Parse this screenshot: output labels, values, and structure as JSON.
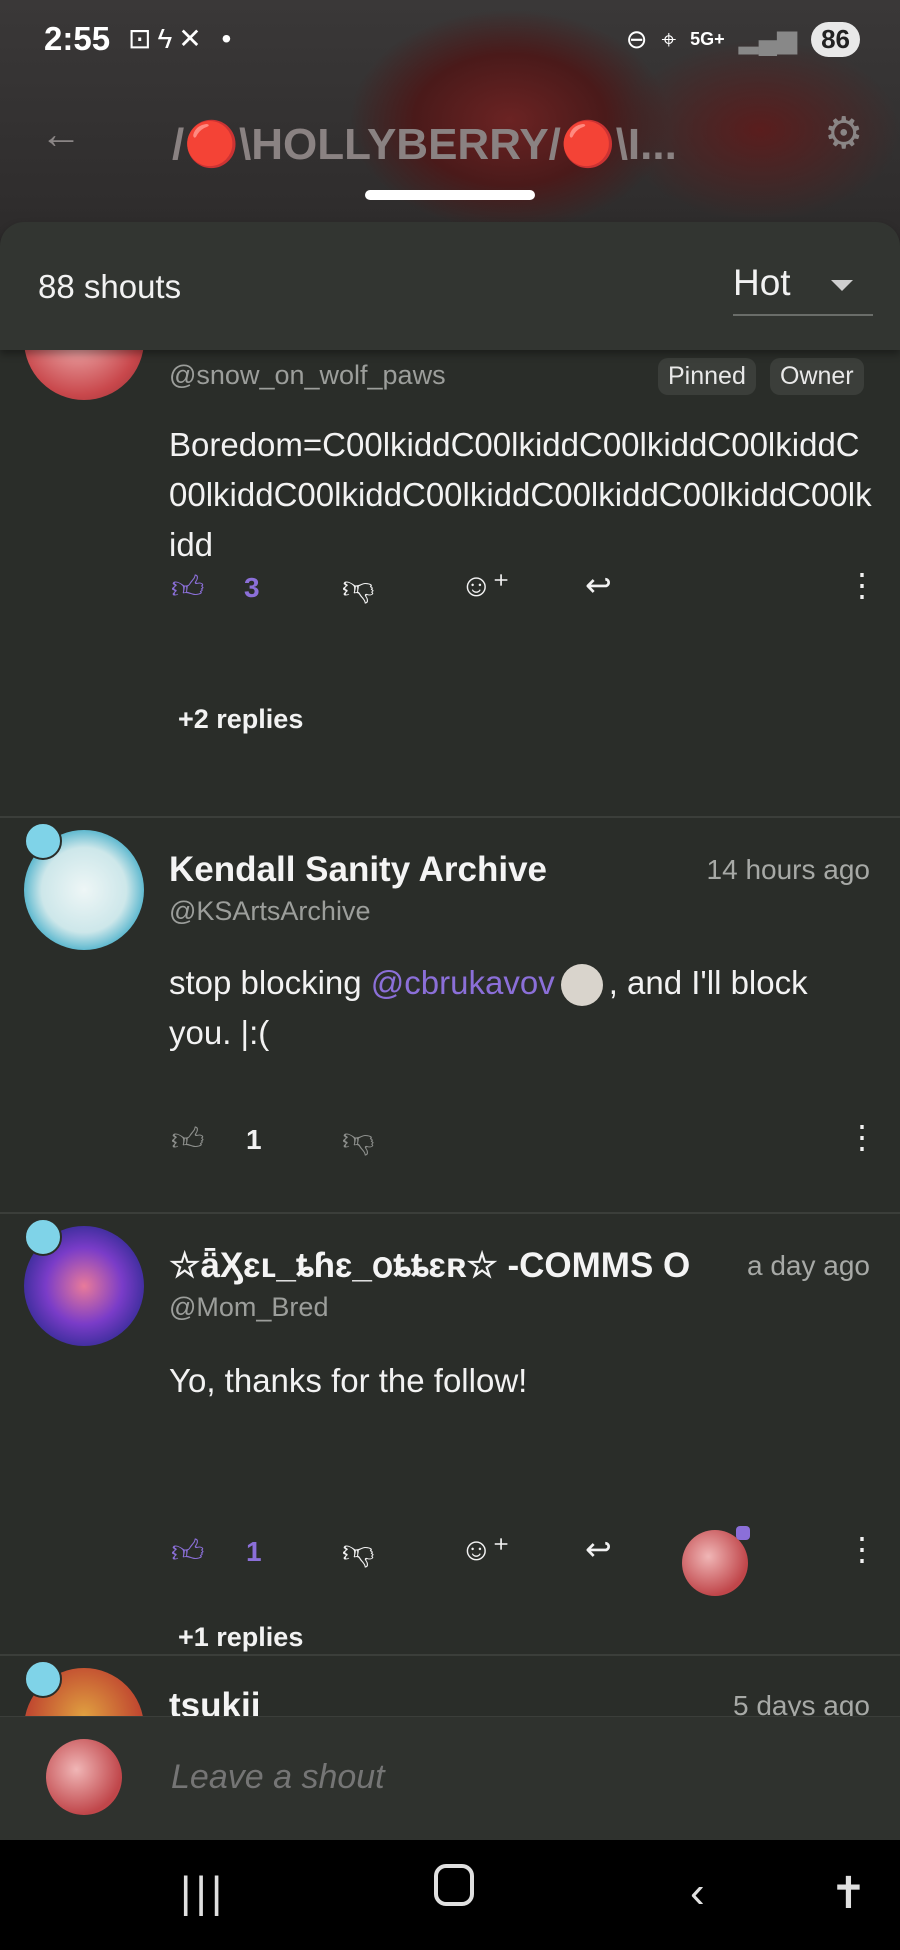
{
  "status": {
    "time": "2:55",
    "battery": "86",
    "network": "5G+"
  },
  "header": {
    "title": "/🔴\\HOLLYBERRY/🔴\\I..."
  },
  "sheet": {
    "count_label": "88 shouts",
    "sort": "Hot"
  },
  "shouts": [
    {
      "handle": "@snow_on_wolf_paws",
      "tags": [
        "Pinned",
        "Owner"
      ],
      "body": "Boredom=C00lkiddC00lkiddC00lkiddC00lkiddC00lkiddC00lkiddC00lkiddC00lkiddC00lkiddC00lkidd",
      "likes": "3",
      "replies": "+2 replies"
    },
    {
      "name": "Kendall Sanity Archive",
      "handle": "@KSArtsArchive",
      "time": "14 hours ago",
      "body_pre": "stop blocking ",
      "mention": "@cbrukavov",
      "body_post": ", and I'll block you. |:(",
      "likes": "1"
    },
    {
      "name": "☆ǟӼɛʟ_ȶɦɛ_օȶȶɛʀ☆ -COMMS O",
      "handle": "@Mom_Bred",
      "time": "a day ago",
      "body": "Yo, thanks for the follow!",
      "likes": "1",
      "replies": "+1 replies"
    },
    {
      "name": "tsukii",
      "time": "5 days ago"
    }
  ],
  "composer": {
    "placeholder": "Leave a shout"
  },
  "colors": {
    "accent": "#8b6fd8",
    "background": "#2a2d29",
    "sheet": "#323531"
  }
}
